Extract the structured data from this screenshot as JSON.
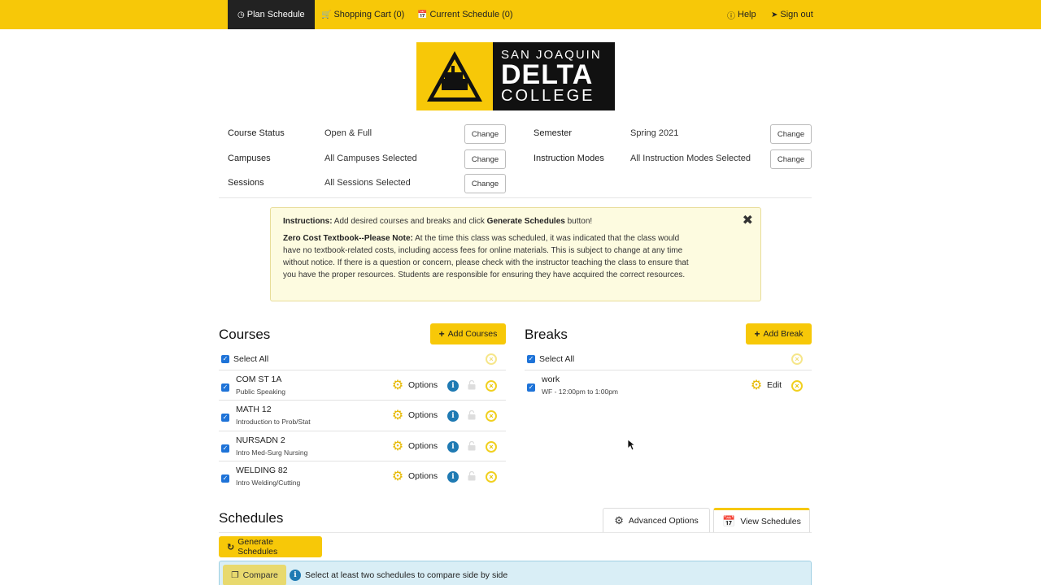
{
  "nav": {
    "plan_schedule": "Plan Schedule",
    "shopping_cart": "Shopping Cart (0)",
    "current_schedule": "Current Schedule (0)",
    "help": "Help",
    "sign_out": "Sign out"
  },
  "logo": {
    "line1": "SAN JOAQUIN",
    "line2": "DELTA",
    "line3": "COLLEGE"
  },
  "filters": {
    "course_status": {
      "label": "Course Status",
      "value": "Open & Full",
      "button": "Change"
    },
    "campuses": {
      "label": "Campuses",
      "value": "All Campuses Selected",
      "button": "Change"
    },
    "sessions": {
      "label": "Sessions",
      "value": "All Sessions Selected",
      "button": "Change"
    },
    "semester": {
      "label": "Semester",
      "value": "Spring 2021",
      "button": "Change"
    },
    "instruction_modes": {
      "label": "Instruction Modes",
      "value": "All Instruction Modes Selected",
      "button": "Change"
    }
  },
  "alert": {
    "instructions_label": "Instructions:",
    "instructions_text_1": " Add desired courses and breaks and click ",
    "instructions_bold": "Generate Schedules",
    "instructions_text_2": " button!",
    "note_label": "Zero Cost Textbook--Please Note:",
    "note_text": " At the time this class was scheduled, it was indicated that the class would have no textbook-related costs, including access fees for online materials. This is subject to change at any time without notice. If there is a question or concern, please check with the instructor teaching the class to ensure that you have the proper resources. Students are responsible for ensuring they have acquired the correct resources."
  },
  "courses": {
    "title": "Courses",
    "add_button": "Add Courses",
    "select_all": "Select All",
    "option_label": "Options",
    "items": [
      {
        "code": "COM ST 1A",
        "name": "Public Speaking"
      },
      {
        "code": "MATH 12",
        "name": "Introduction to Prob/Stat"
      },
      {
        "code": "NURSADN 2",
        "name": "Intro Med-Surg Nursing"
      },
      {
        "code": "WELDING 82",
        "name": "Intro Welding/Cutting"
      }
    ]
  },
  "breaks": {
    "title": "Breaks",
    "add_button": "Add Break",
    "select_all": "Select All",
    "items": [
      {
        "name": "work",
        "time": "WF - 12:00pm to 1:00pm",
        "edit_label": "Edit"
      }
    ]
  },
  "schedules": {
    "title": "Schedules",
    "advanced_tab": "Advanced Options",
    "view_tab": "View Schedules",
    "generate_button": "Generate Schedules",
    "compare_button": "Compare",
    "compare_hint": "Select at least two schedules to compare side by side"
  },
  "colors": {
    "accent": "#f7c808",
    "info": "#1f7ab3",
    "checkbox": "#1e73d8"
  },
  "icons": [
    "clock-icon",
    "cart-icon",
    "calendar-icon",
    "help-icon",
    "sign-out-icon",
    "gear-icon",
    "info-icon",
    "lock-icon",
    "remove-icon",
    "close-icon",
    "gears-icon",
    "refresh-icon",
    "copy-icon"
  ]
}
